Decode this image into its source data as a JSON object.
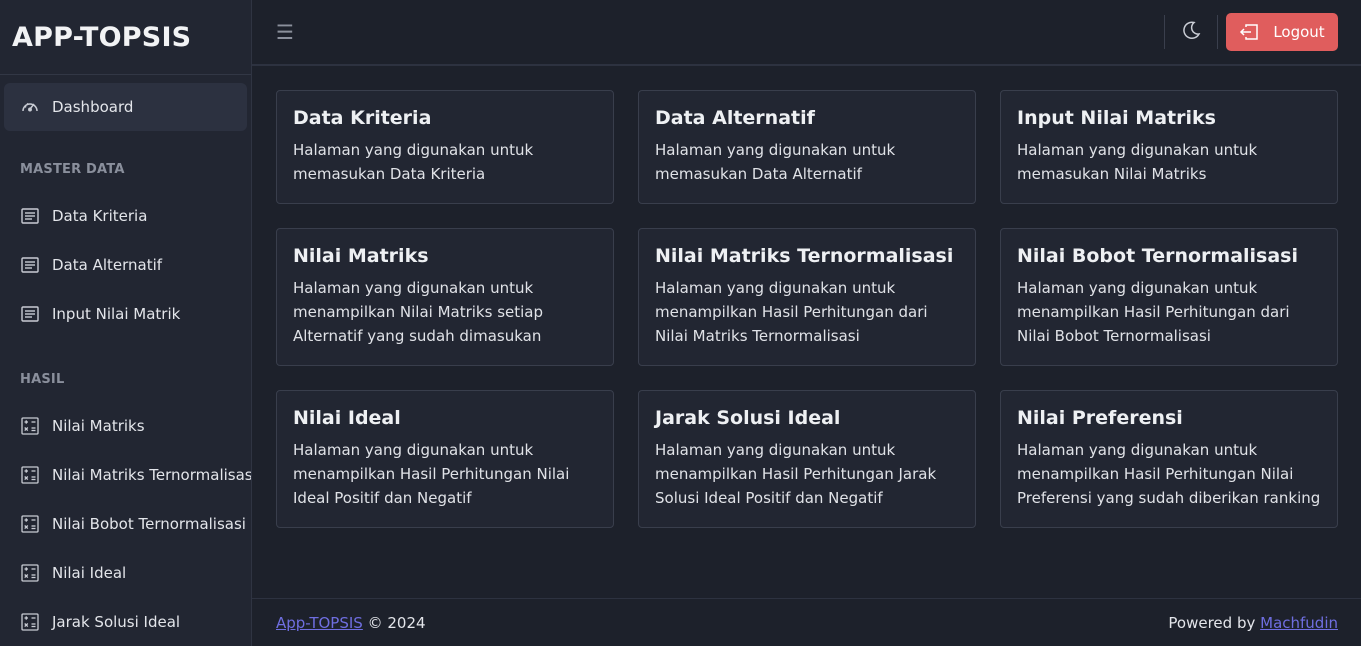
{
  "brand": "APP-TOPSIS",
  "sidebar": {
    "dashboard": "Dashboard",
    "master_heading": "MASTER DATA",
    "master_items": [
      {
        "label": "Data Kriteria",
        "icon": "document-icon"
      },
      {
        "label": "Data Alternatif",
        "icon": "document-icon"
      },
      {
        "label": "Input Nilai Matrik",
        "icon": "document-icon"
      }
    ],
    "hasil_heading": "HASIL",
    "hasil_items": [
      {
        "label": "Nilai Matriks",
        "icon": "calculator-icon"
      },
      {
        "label": "Nilai Matriks Ternormalisasi",
        "icon": "calculator-icon"
      },
      {
        "label": "Nilai Bobot Ternormalisasi",
        "icon": "calculator-icon"
      },
      {
        "label": "Nilai Ideal",
        "icon": "calculator-icon"
      },
      {
        "label": "Jarak Solusi Ideal",
        "icon": "calculator-icon"
      }
    ]
  },
  "topbar": {
    "menu_icon": "☰",
    "logout_label": "Logout",
    "logout_color": "#e05d5d"
  },
  "cards": [
    {
      "title": "Data Kriteria",
      "desc": "Halaman yang digunakan untuk memasukan Data Kriteria"
    },
    {
      "title": "Data Alternatif",
      "desc": "Halaman yang digunakan untuk memasukan Data Alternatif"
    },
    {
      "title": "Input Nilai Matriks",
      "desc": "Halaman yang digunakan untuk memasukan Nilai Matriks"
    },
    {
      "title": "Nilai Matriks",
      "desc": "Halaman yang digunakan untuk menampilkan Nilai Matriks setiap Alternatif yang sudah dimasukan"
    },
    {
      "title": "Nilai Matriks Ternormalisasi",
      "desc": "Halaman yang digunakan untuk menampilkan Hasil Perhitungan dari Nilai Matriks Ternormalisasi"
    },
    {
      "title": "Nilai Bobot Ternormalisasi",
      "desc": "Halaman yang digunakan untuk menampilkan Hasil Perhitungan dari Nilai Bobot Ternormalisasi"
    },
    {
      "title": "Nilai Ideal",
      "desc": "Halaman yang digunakan untuk menampilkan Hasil Perhitungan Nilai Ideal Positif dan Negatif"
    },
    {
      "title": "Jarak Solusi Ideal",
      "desc": "Halaman yang digunakan untuk menampilkan Hasil Perhitungan Jarak Solusi Ideal Positif dan Negatif"
    },
    {
      "title": "Nilai Preferensi",
      "desc": "Halaman yang digunakan untuk menampilkan Hasil Perhitungan Nilai Preferensi yang sudah diberikan ranking"
    }
  ],
  "footer": {
    "app_link": "App-TOPSIS",
    "copyright": " © 2024",
    "powered_by": "Powered by ",
    "author_link": "Machfudin",
    "link_color": "#6f6ee0"
  }
}
